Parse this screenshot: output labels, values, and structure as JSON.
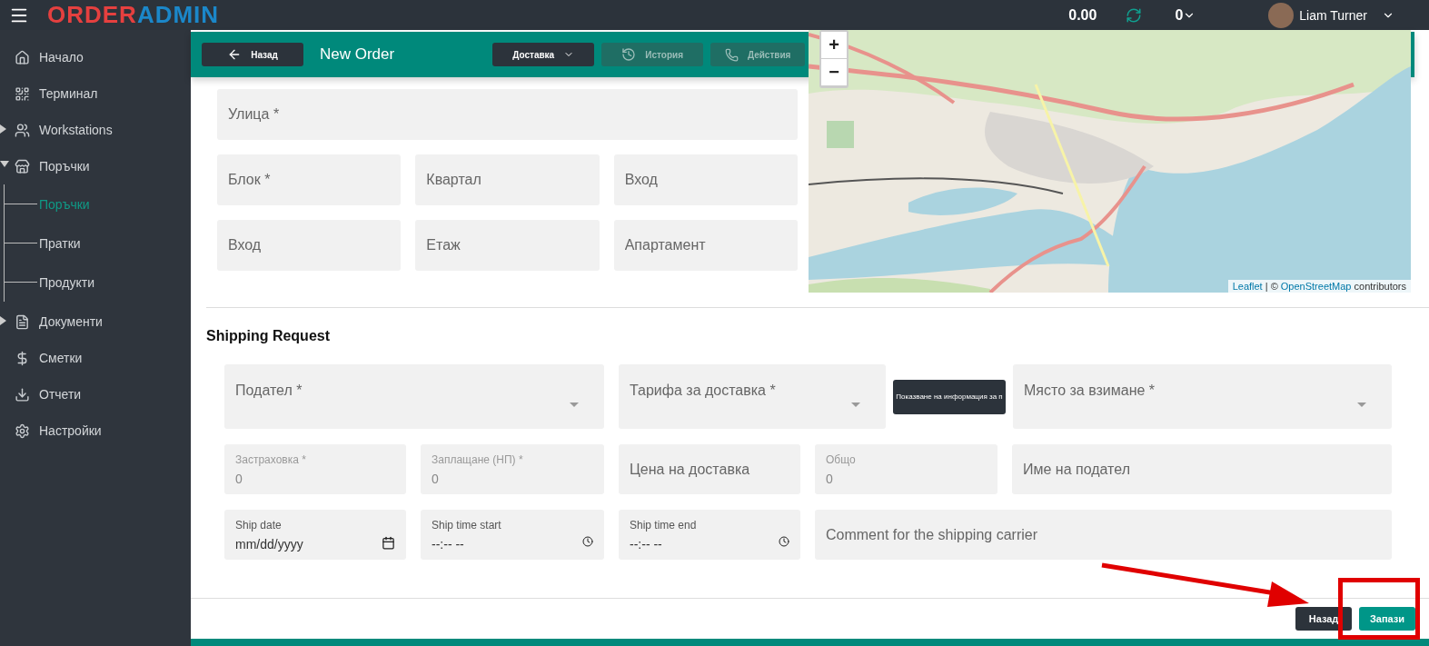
{
  "top_bar": {
    "logo": {
      "part1": "ORDER",
      "part2": "ADMIN"
    },
    "balance": "0.00",
    "counter": "0",
    "user": "Liam Turner"
  },
  "sidebar": {
    "items": [
      {
        "label": "Начало",
        "kind": "link"
      },
      {
        "label": "Терминал",
        "kind": "link"
      },
      {
        "label": "Workstations",
        "kind": "group",
        "expanded": false
      },
      {
        "label": "Поръчки",
        "kind": "group",
        "expanded": true,
        "children": [
          {
            "label": "Поръчки",
            "selected": true
          },
          {
            "label": "Пратки",
            "selected": false
          },
          {
            "label": "Продукти",
            "selected": false
          }
        ]
      },
      {
        "label": "Документи",
        "kind": "group",
        "expanded": false
      },
      {
        "label": "Сметки",
        "kind": "link"
      },
      {
        "label": "Отчети",
        "kind": "link"
      },
      {
        "label": "Настройки",
        "kind": "link"
      }
    ]
  },
  "header": {
    "back": "Назад",
    "title": "New Order",
    "buttons": [
      {
        "label": "Доставка",
        "kind": "dropdown",
        "disabled": false
      },
      {
        "label": "История",
        "kind": "history",
        "disabled": true
      },
      {
        "label": "Действия",
        "kind": "phone",
        "disabled": true
      }
    ]
  },
  "address": {
    "rows": [
      [
        {
          "placeholder": "Улица *"
        }
      ],
      [
        {
          "placeholder": "Блок *"
        },
        {
          "placeholder": "Квартал"
        },
        {
          "placeholder": "Вход"
        }
      ],
      [
        {
          "placeholder": "Вход"
        },
        {
          "placeholder": "Етаж"
        },
        {
          "placeholder": "Апартамент"
        }
      ]
    ]
  },
  "map": {
    "zoom_in": "+",
    "zoom_out": "−",
    "attribution": {
      "link1": "Leaflet",
      "separator": " | © ",
      "link2": "OpenStreetMap",
      "tail": " contributors"
    }
  },
  "shipping": {
    "title": "Shipping Request",
    "row1": [
      {
        "kind": "select",
        "label": "Подател *"
      },
      {
        "kind": "select",
        "label": "Тарифа за доставка *"
      },
      {
        "kind": "button",
        "label": "Показване на информация за п"
      },
      {
        "kind": "select",
        "label": "Място за взимане *"
      }
    ],
    "row2": [
      {
        "kind": "filled",
        "label": "Застраховка *",
        "value": "0"
      },
      {
        "kind": "filled",
        "label": "Заплащане (НП) *",
        "value": "0"
      },
      {
        "kind": "input",
        "placeholder": "Цена на доставка"
      },
      {
        "kind": "filled",
        "label": "Общо",
        "value": "0"
      },
      {
        "kind": "input",
        "placeholder": "Име на подател"
      }
    ],
    "row3": [
      {
        "kind": "date",
        "label": "Ship date",
        "value": "mm/dd/yyyy"
      },
      {
        "kind": "time",
        "label": "Ship time start",
        "value": "--:-- --"
      },
      {
        "kind": "time",
        "label": "Ship time end",
        "value": "--:-- --"
      },
      {
        "kind": "input",
        "placeholder": "Comment for the shipping carrier"
      }
    ]
  },
  "footer": {
    "buttons": [
      {
        "label": "Назад",
        "kind": "secondary"
      },
      {
        "label": "Запази",
        "kind": "primary"
      }
    ]
  }
}
